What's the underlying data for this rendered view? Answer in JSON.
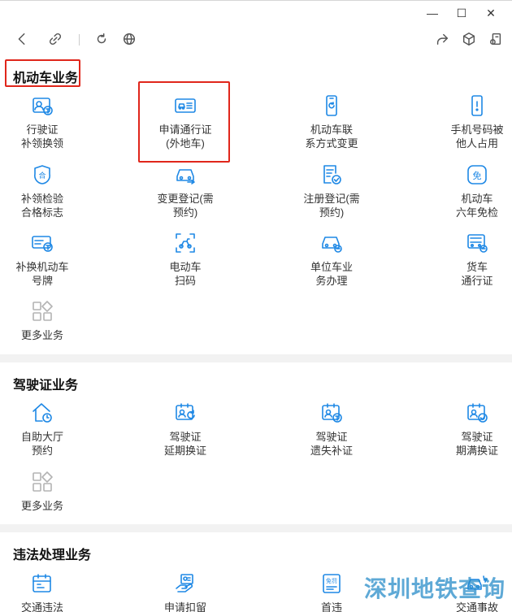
{
  "window": {
    "minimize": "—",
    "maximize": "☐",
    "close": "✕"
  },
  "toolbar": {
    "back": "back-icon",
    "link": "link-icon",
    "refresh": "refresh-icon",
    "globe": "globe-icon",
    "share": "share-icon",
    "cube": "cube-icon",
    "exit": "exit-icon"
  },
  "sections": {
    "vehicle": {
      "title": "机动车业务",
      "items": [
        {
          "label": "行驶证\n补领换领",
          "icon": "license-card-icon"
        },
        {
          "label": "申请通行证\n(外地车)",
          "icon": "pass-card-icon"
        },
        {
          "label": "机动车联\n系方式变更",
          "icon": "phone-refresh-icon"
        },
        {
          "label": "手机号码被\n他人占用",
          "icon": "phone-alert-icon"
        },
        {
          "label": "补领检验\n合格标志",
          "icon": "shield-icon"
        },
        {
          "label": "变更登记(需\n预约)",
          "icon": "car-change-icon"
        },
        {
          "label": "注册登记(需\n预约)",
          "icon": "register-doc-icon"
        },
        {
          "label": "机动车\n六年免检",
          "icon": "exempt-icon"
        },
        {
          "label": "补换机动车\n号牌",
          "icon": "plate-icon"
        },
        {
          "label": "电动车\n扫码",
          "icon": "scooter-scan-icon"
        },
        {
          "label": "单位车业\n务办理",
          "icon": "company-car-icon"
        },
        {
          "label": "货车\n通行证",
          "icon": "truck-pass-icon"
        },
        {
          "label": "更多业务",
          "icon": "more-grid-icon"
        }
      ]
    },
    "driver": {
      "title": "驾驶证业务",
      "items": [
        {
          "label": "自助大厅\n预约",
          "icon": "hall-clock-icon"
        },
        {
          "label": "驾驶证\n延期换证",
          "icon": "license-renew-icon"
        },
        {
          "label": "驾驶证\n遗失补证",
          "icon": "license-lost-icon"
        },
        {
          "label": "驾驶证\n期满换证",
          "icon": "license-expire-icon"
        },
        {
          "label": "更多业务",
          "icon": "more-grid-icon"
        }
      ]
    },
    "violation": {
      "title": "违法处理业务",
      "items": [
        {
          "label": "交通违法",
          "icon": "calendar-icon"
        },
        {
          "label": "申请扣留",
          "icon": "hand-card-icon"
        },
        {
          "label": "首违",
          "icon": "first-offense-icon"
        },
        {
          "label": "交通事故",
          "icon": "accident-icon"
        }
      ]
    }
  },
  "watermark": "深圳地铁查询",
  "colors": {
    "accent": "#1e88e5",
    "highlight": "#e0261b",
    "grey_icon": "#b3b3b3"
  }
}
